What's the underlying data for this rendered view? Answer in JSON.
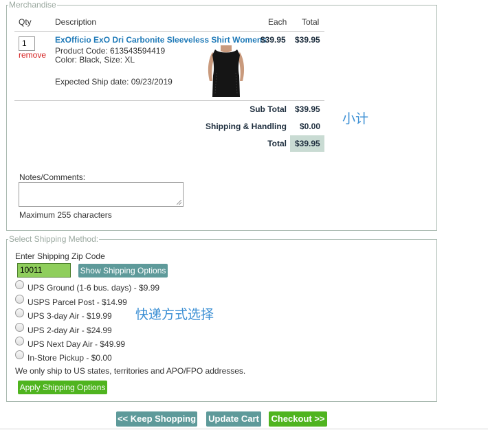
{
  "merchandise": {
    "legend": "Merchandise",
    "columns": {
      "qty": "Qty",
      "description": "Description",
      "each": "Each",
      "total": "Total"
    },
    "item": {
      "qty": "1",
      "remove_label": "remove",
      "name": "ExOfficio ExO Dri Carbonite Sleeveless Shirt Womens",
      "product_code": "Product Code: 613543594419",
      "color_size": "Color: Black, Size: XL",
      "ship_date": "Expected Ship date: 09/23/2019",
      "each": "$39.95",
      "total": "$39.95"
    },
    "summary": {
      "subtotal_label": "Sub Total",
      "subtotal_value": "$39.95",
      "shipping_label": "Shipping & Handling",
      "shipping_value": "$0.00",
      "total_label": "Total",
      "total_value": "$39.95"
    },
    "annotation_subtotal": "小计",
    "notes_label": "Notes/Comments:",
    "notes_value": "",
    "notes_hint": "Maximum 255 characters"
  },
  "shipping": {
    "legend": "Select Shipping Method:",
    "zip_label": "Enter Shipping Zip Code",
    "zip_value": "10011",
    "show_options_label": "Show Shipping Options",
    "options": [
      "UPS Ground (1-6 bus. days) - $9.99",
      "USPS Parcel Post - $14.99",
      "UPS 3-day Air - $19.99",
      "UPS 2-day Air - $24.99",
      "UPS Next Day Air - $49.99",
      "In-Store Pickup - $0.00"
    ],
    "annotation_method": "快递方式选择",
    "note": "We only ship to US states, territories and APO/FPO addresses.",
    "apply_label": "Apply Shipping Options"
  },
  "footer": {
    "keep_shopping_label": "<< Keep Shopping",
    "update_cart_label": "Update Cart",
    "checkout_label": "Checkout >>"
  },
  "colors": {
    "teal_button": "#5e9a9a",
    "green_button": "#4fb41f",
    "product_link": "#1f7ab8",
    "remove_link": "#d42020",
    "total_highlight": "#c9dbd3",
    "zip_field": "#8fce5c",
    "annotation": "#3b8fd4"
  }
}
